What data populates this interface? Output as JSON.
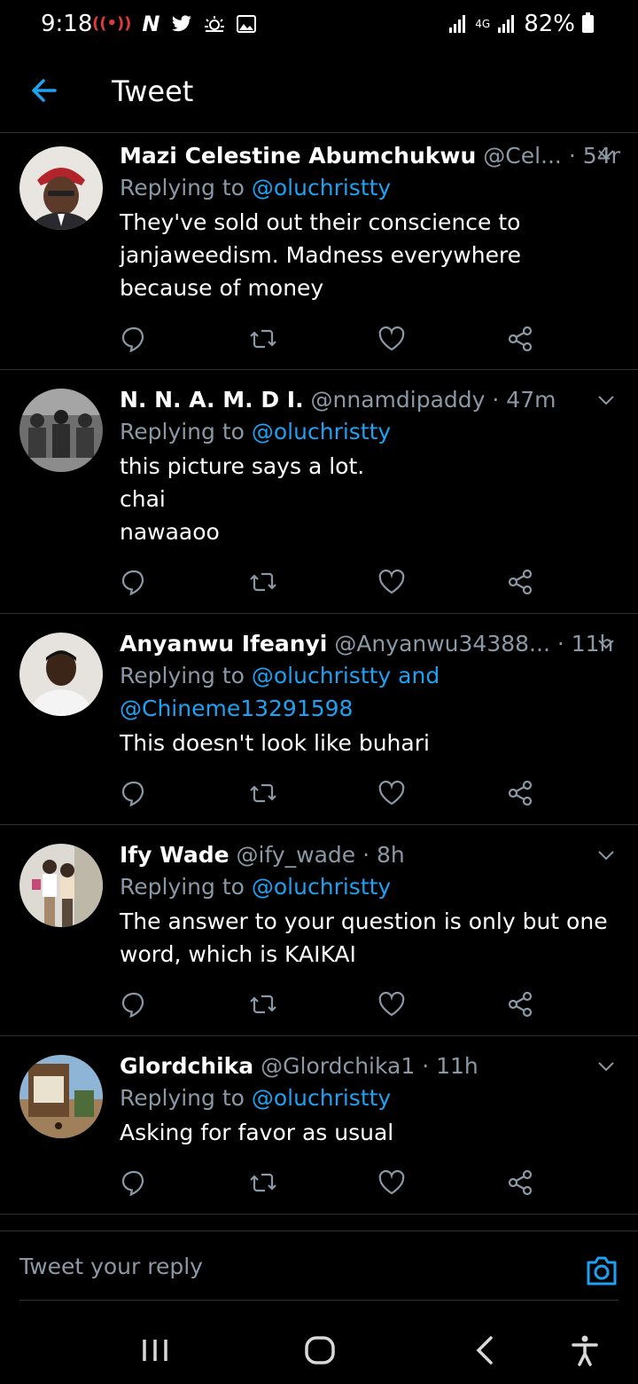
{
  "status_bar": {
    "time": "9:18",
    "network": "4G",
    "battery": "82%"
  },
  "header": {
    "title": "Tweet"
  },
  "tweets": [
    {
      "name": "Mazi Celestine Abumchukwu",
      "meta": "@Cel... · 54m",
      "replying_prefix": "Replying to ",
      "replying_to": "@oluchristty",
      "lines": [
        "They've sold out their conscience to janjaweedism. Madness everywhere because of money"
      ]
    },
    {
      "name": "N. N. A. M. D I.",
      "meta": "@nnamdipaddy · 47m",
      "replying_prefix": "Replying to ",
      "replying_to": "@oluchristty",
      "lines": [
        "this picture says a lot.",
        "chai",
        "nawaaoo"
      ]
    },
    {
      "name": "Anyanwu Ifeanyi",
      "meta": "@Anyanwu34388...  · 11h",
      "replying_prefix": "Replying to ",
      "replying_to": "@oluchristty and @Chineme13291598",
      "lines": [
        "This doesn't look like buhari"
      ]
    },
    {
      "name": "Ify Wade",
      "meta": "@ify_wade · 8h",
      "replying_prefix": "Replying to ",
      "replying_to": "@oluchristty",
      "lines": [
        "The answer to your question is only but one word, which is KAIKAI"
      ]
    },
    {
      "name": "Glordchika",
      "meta": "@Glordchika1 · 11h",
      "replying_prefix": "Replying to ",
      "replying_to": "@oluchristty",
      "lines": [
        "Asking for favor as usual"
      ]
    }
  ],
  "composer": {
    "placeholder": "Tweet your reply"
  },
  "colors": {
    "background": "#000000",
    "accent": "#1da1f2",
    "muted": "#8b98a5",
    "divider": "#2f3336",
    "signal_red": "#e03b3b"
  },
  "icons": [
    "back-arrow-icon",
    "chevron-down-icon",
    "reply-icon",
    "retweet-icon",
    "like-icon",
    "share-icon",
    "camera-icon",
    "recents-icon",
    "home-icon",
    "back-icon",
    "accessibility-icon"
  ]
}
